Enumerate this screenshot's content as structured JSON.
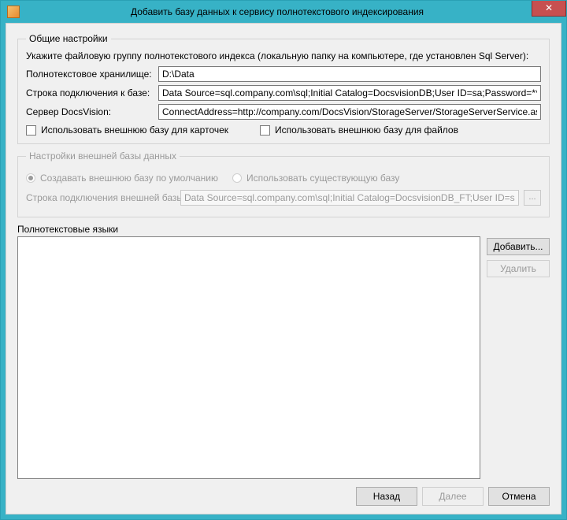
{
  "window": {
    "title": "Добавить базу данных к сервису полнотекстового индексирования"
  },
  "general": {
    "legend": "Общие настройки",
    "description": "Укажите файловую группу полнотекстового индекса (локальную папку на компьютере, где установлен Sql Server):",
    "storage_label": "Полнотекстовое хранилище:",
    "storage_value": "D:\\Data",
    "conn_label": "Строка подключения к базе:",
    "conn_value": "Data Source=sql.company.com\\sql;Initial Catalog=DocsvisionDB;User ID=sa;Password=****",
    "server_label": "Сервер DocsVision:",
    "server_value": "ConnectAddress=http://company.com/DocsVision/StorageServer/StorageServerService.asmx",
    "chk_cards": "Использовать внешнюю базу для карточек",
    "chk_files": "Использовать внешнюю базу для файлов"
  },
  "external": {
    "legend": "Настройки внешней базы данных",
    "radio_create": "Создавать внешнюю базу по умолчанию",
    "radio_existing": "Использовать существующую базу",
    "conn_label": "Строка подключения внешней базы:",
    "conn_value": "Data Source=sql.company.com\\sql;Initial Catalog=DocsvisionDB_FT;User ID=sa;Passwor",
    "browse": "..."
  },
  "languages": {
    "label": "Полнотекстовые языки",
    "add": "Добавить...",
    "remove": "Удалить"
  },
  "buttons": {
    "back": "Назад",
    "next": "Далее",
    "cancel": "Отмена"
  }
}
